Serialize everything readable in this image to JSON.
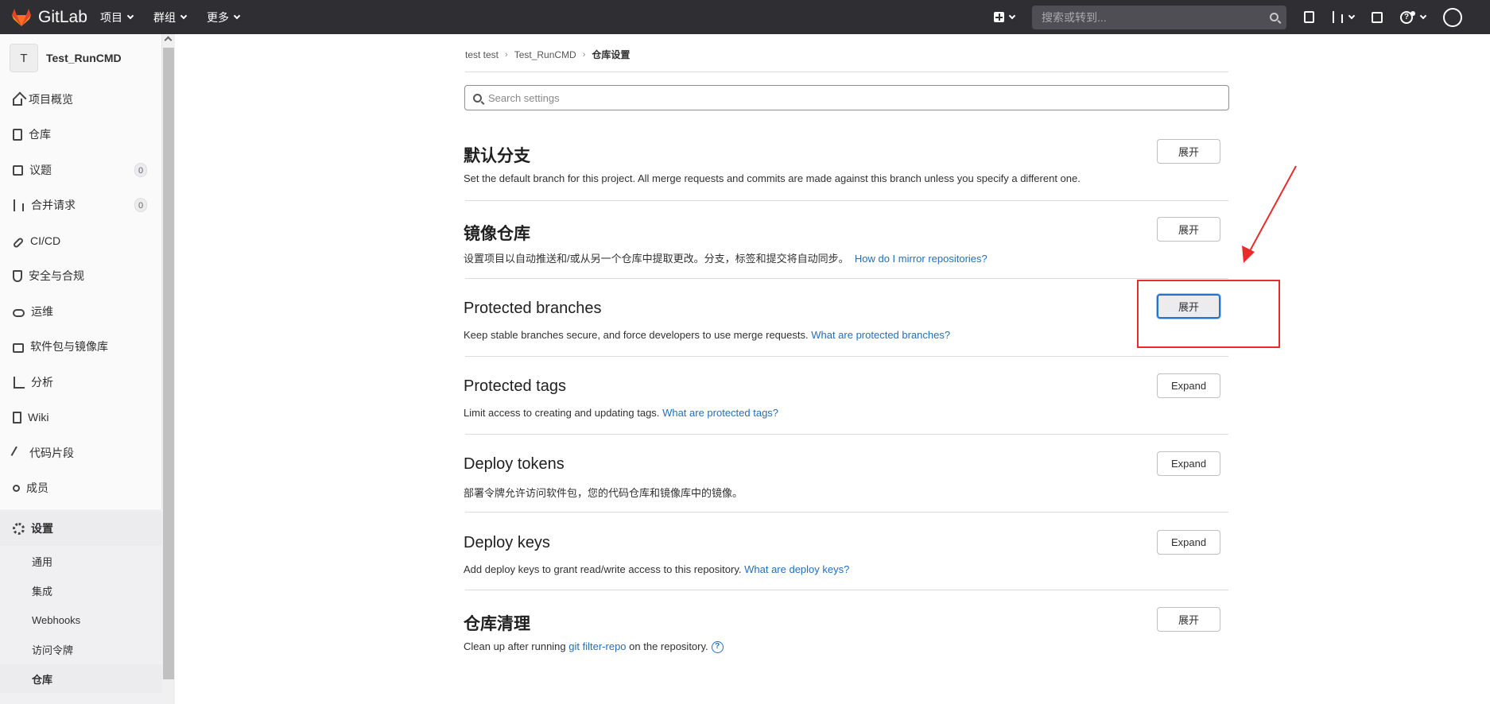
{
  "topbar": {
    "brand": "GitLab",
    "nav": [
      "项目",
      "群组",
      "更多"
    ],
    "search_placeholder": "搜索或转到...",
    "help_glyph": "?"
  },
  "sidebar": {
    "project_initial": "T",
    "project_name": "Test_RunCMD",
    "items": [
      {
        "label": "项目概览",
        "icon": "home-icon"
      },
      {
        "label": "仓库",
        "icon": "file-icon"
      },
      {
        "label": "议题",
        "icon": "issues-icon",
        "badge": "0"
      },
      {
        "label": "合并请求",
        "icon": "merge-request-icon",
        "badge": "0"
      },
      {
        "label": "CI/CD",
        "icon": "rocket-icon"
      },
      {
        "label": "安全与合规",
        "icon": "shield-icon"
      },
      {
        "label": "运维",
        "icon": "cloud-icon"
      },
      {
        "label": "软件包与镜像库",
        "icon": "package-icon"
      },
      {
        "label": "分析",
        "icon": "chart-icon"
      },
      {
        "label": "Wiki",
        "icon": "book-icon"
      },
      {
        "label": "代码片段",
        "icon": "snippet-icon"
      },
      {
        "label": "成员",
        "icon": "users-icon"
      },
      {
        "label": "设置",
        "icon": "gear-icon"
      }
    ],
    "sub_items": [
      "通用",
      "集成",
      "Webhooks",
      "访问令牌",
      "仓库"
    ]
  },
  "breadcrumb": {
    "items": [
      "test test",
      "Test_RunCMD",
      "仓库设置"
    ]
  },
  "settings_search": {
    "placeholder": "Search settings"
  },
  "sections": [
    {
      "title": "默认分支",
      "desc": "Set the default branch for this project. All merge requests and commits are made against this branch unless you specify a different one.",
      "button": "展开"
    },
    {
      "title": "镜像仓库",
      "desc": "设置项目以自动推送和/或从另一个仓库中提取更改。分支，标签和提交将自动同步。",
      "link": "How do I mirror repositories?",
      "button": "展开"
    },
    {
      "title": "Protected branches",
      "desc": "Keep stable branches secure, and force developers to use merge requests.",
      "link": "What are protected branches?",
      "button": "展开"
    },
    {
      "title": "Protected tags",
      "desc": "Limit access to creating and updating tags.",
      "link": "What are protected tags?",
      "button": "Expand"
    },
    {
      "title": "Deploy tokens",
      "desc": "部署令牌允许访问软件包，您的代码仓库和镜像库中的镜像。",
      "button": "Expand"
    },
    {
      "title": "Deploy keys",
      "desc": "Add deploy keys to grant read/write access to this repository.",
      "link": "What are deploy keys?",
      "button": "Expand"
    },
    {
      "title": "仓库清理",
      "desc_before": "Clean up after running",
      "link": "git filter-repo",
      "desc_after": "on the repository.",
      "help_glyph": "?",
      "button": "展开"
    }
  ],
  "colors": {
    "topbar": "#2f2f33",
    "link": "#1f6fbf",
    "annotation": "#e82c2c"
  }
}
